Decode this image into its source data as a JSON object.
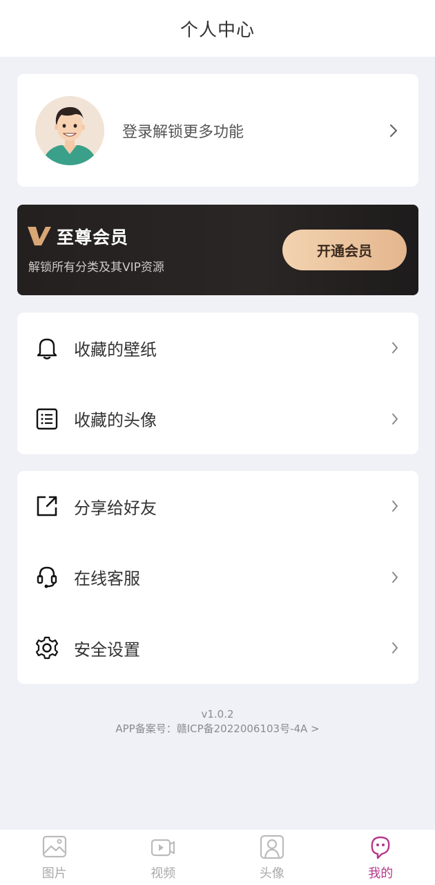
{
  "header": {
    "title": "个人中心"
  },
  "profile": {
    "login_text": "登录解锁更多功能"
  },
  "vip": {
    "title": "至尊会员",
    "subtitle": "解锁所有分类及其VIP资源",
    "button_label": "开通会员"
  },
  "menu_group_1": [
    {
      "label": "收藏的壁纸",
      "icon": "bell-icon"
    },
    {
      "label": "收藏的头像",
      "icon": "list-icon"
    }
  ],
  "menu_group_2": [
    {
      "label": "分享给好友",
      "icon": "share-icon"
    },
    {
      "label": "在线客服",
      "icon": "headset-icon"
    },
    {
      "label": "安全设置",
      "icon": "gear-icon"
    }
  ],
  "footer": {
    "version": "v1.0.2",
    "record": "APP备案号：赣ICP备2022006103号-4A  >"
  },
  "tabs": [
    {
      "label": "图片",
      "icon": "image-icon",
      "active": false
    },
    {
      "label": "视频",
      "icon": "video-icon",
      "active": false
    },
    {
      "label": "头像",
      "icon": "portrait-icon",
      "active": false
    },
    {
      "label": "我的",
      "icon": "mine-icon",
      "active": true
    }
  ],
  "colors": {
    "accent": "#b8368a",
    "vip_gold": "#e4b68e",
    "background": "#f0f1f6"
  }
}
